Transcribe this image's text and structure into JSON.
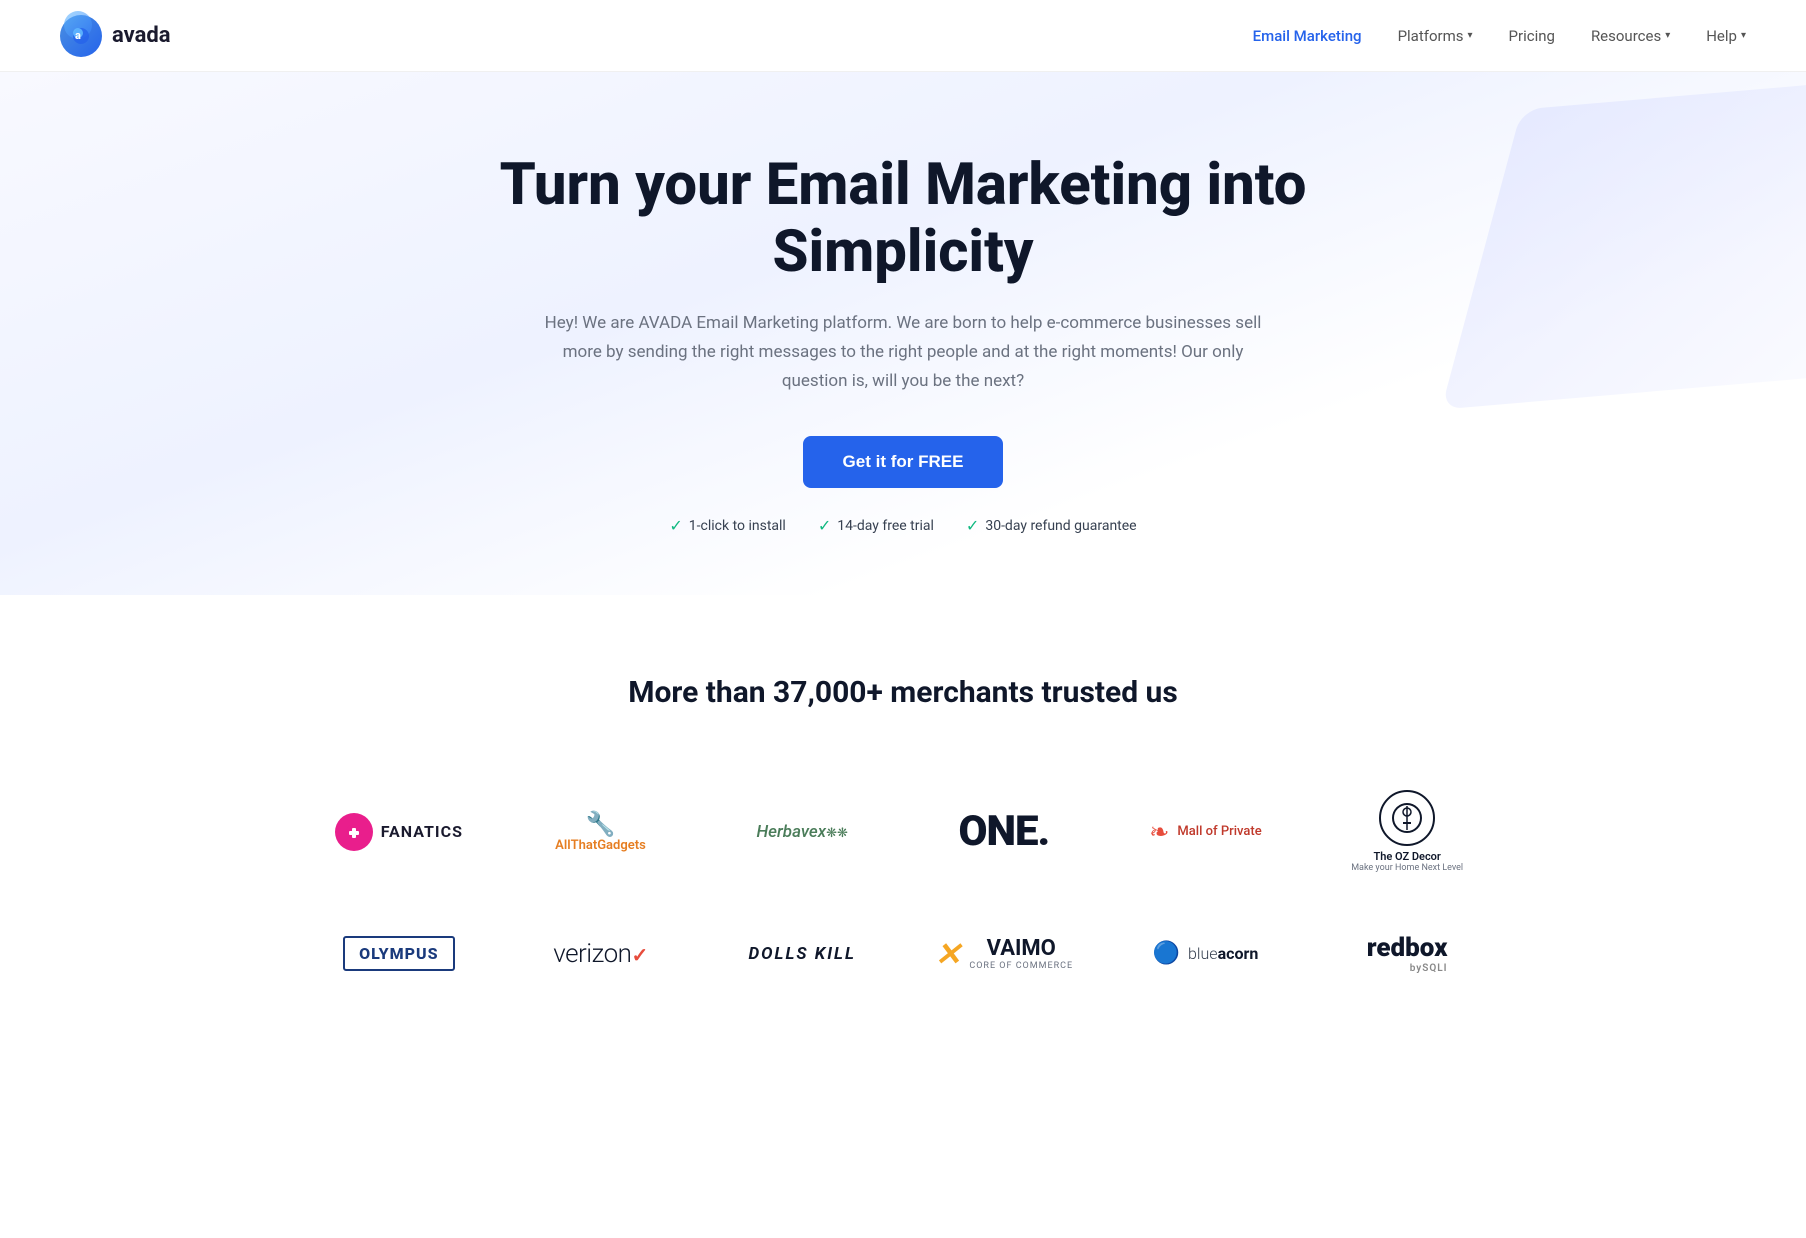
{
  "nav": {
    "logo_letter": "a",
    "logo_name": "avada",
    "links": [
      {
        "label": "Email Marketing",
        "active": true,
        "has_dropdown": false
      },
      {
        "label": "Platforms",
        "active": false,
        "has_dropdown": true
      },
      {
        "label": "Pricing",
        "active": false,
        "has_dropdown": false
      },
      {
        "label": "Resources",
        "active": false,
        "has_dropdown": true
      },
      {
        "label": "Help",
        "active": false,
        "has_dropdown": true
      }
    ]
  },
  "hero": {
    "title": "Turn your Email Marketing into Simplicity",
    "subtitle": "Hey! We are AVADA Email Marketing platform. We are born to help e-commerce businesses sell more by sending the right messages to the right people and at the right moments! Our only question is, will you be the next?",
    "cta_label": "Get it for FREE",
    "features": [
      {
        "label": "1-click to install"
      },
      {
        "label": "14-day free trial"
      },
      {
        "label": "30-day refund guarantee"
      }
    ]
  },
  "merchants": {
    "title": "More than 37,000+ merchants trusted us",
    "logos_row1": [
      {
        "id": "fanatics",
        "name": "Fanatics"
      },
      {
        "id": "allgadgets",
        "name": "AllThatGadgets"
      },
      {
        "id": "herbavex",
        "name": "Herbavex"
      },
      {
        "id": "one",
        "name": "ONE."
      },
      {
        "id": "mallofprivate",
        "name": "Mall of Private"
      },
      {
        "id": "ozdecor",
        "name": "The OZ Decor"
      }
    ],
    "logos_row2": [
      {
        "id": "olympus",
        "name": "OLYMPUS"
      },
      {
        "id": "verizon",
        "name": "verizon"
      },
      {
        "id": "dollskill",
        "name": "DOLLS KILL"
      },
      {
        "id": "vaimo",
        "name": "VAIMO"
      },
      {
        "id": "blueacorn",
        "name": "blue acorn"
      },
      {
        "id": "redbox",
        "name": "redbox"
      }
    ]
  }
}
